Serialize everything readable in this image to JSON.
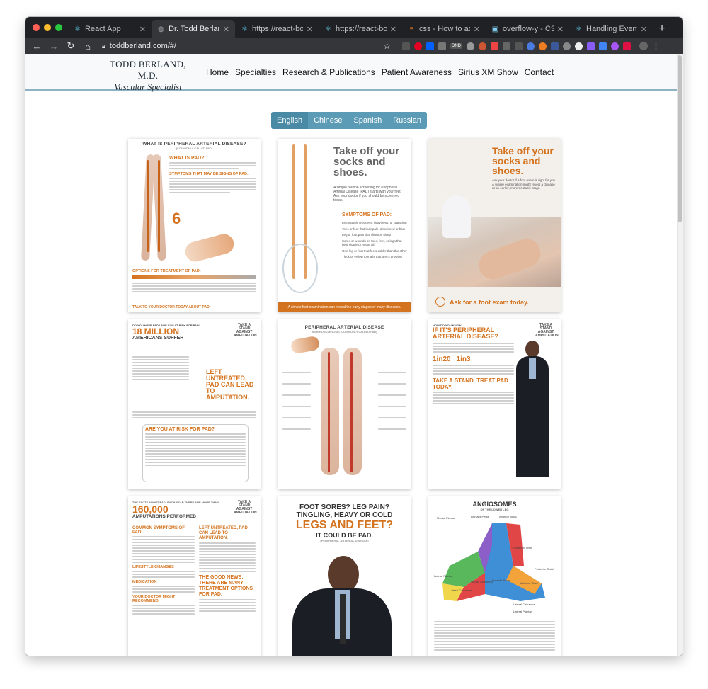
{
  "browser": {
    "tabs": [
      {
        "label": "React App",
        "icon": "react-icon",
        "active": false
      },
      {
        "label": "Dr. Todd Berland, MD",
        "icon": "globe-icon",
        "active": true
      },
      {
        "label": "https://react-bootstr",
        "icon": "react-icon",
        "active": false
      },
      {
        "label": "https://react-bootstr",
        "icon": "react-icon",
        "active": false
      },
      {
        "label": "css - How to add a s",
        "icon": "stackoverflow-icon",
        "active": false
      },
      {
        "label": "overflow-y - CSS: Ca",
        "icon": "mdn-icon",
        "active": false
      },
      {
        "label": "Handling Events – Re",
        "icon": "react-icon",
        "active": false
      }
    ],
    "url": "toddberland.com/#/",
    "extension_badge": "DND"
  },
  "site": {
    "brand_name": "TODD BERLAND, M.D.",
    "brand_sub": "Vascular Specialist",
    "nav": [
      "Home",
      "Specialties",
      "Research & Publications",
      "Patient Awareness",
      "Sirius XM Show",
      "Contact"
    ],
    "languages": [
      "English",
      "Chinese",
      "Spanish",
      "Russian"
    ],
    "active_language": "English"
  },
  "posters": {
    "p1": {
      "title": "WHAT IS PERIPHERAL ARTERIAL DISEASE?",
      "sub": "(COMMONLY CALLED PAD)",
      "h1": "WHAT IS PAD?",
      "h2": "SYMPTOMS THAT MAY BE SIGNS OF PAD:",
      "h3": "OPTIONS FOR TREATMENT OF PAD:",
      "footer": "TALK TO YOUR DOCTOR TODAY ABOUT PAD.",
      "big": "6"
    },
    "p2": {
      "title": "Take off your socks and shoes.",
      "body": "A simple routine screening for Peripheral Arterial Disease (PAD) starts with your feet. Ask your doctor if you should be screened today.",
      "symptoms_title": "SYMPTOMS OF PAD:",
      "symptoms": [
        "Leg muscle tiredness, heaviness, or cramping",
        "Toes or feet that look pale, discolored or blue",
        "Leg or foot pain that disturbs sleep",
        "Sores or wounds on toes, feet, or legs that heal slowly or not at all",
        "One leg or foot that feels colder than the other",
        "Thick or yellow toenails that aren't growing"
      ],
      "footer": "A simple foot examination can reveal the early stages of many diseases."
    },
    "p3": {
      "title": "Take off your socks and shoes.",
      "body": "Ask your doctor if a foot exam is right for you. A simple examination might reveal a disease at an earlier, more treatable stage.",
      "footer": "Ask for a foot exam today."
    },
    "p4": {
      "pre": "DO YOU HAVE PAD? ARE YOU AT RISK FOR PAD?",
      "big": "18 MILLION",
      "big2": "AMERICANS SUFFER",
      "mid": "LEFT UNTREATED, PAD CAN LEAD TO AMPUTATION.",
      "quiz": "ARE YOU AT RISK FOR PAD?",
      "logo": "TAKE A STAND AGAINST AMPUTATION"
    },
    "p5": {
      "title": "PERIPHERAL ARTERIAL DISEASE",
      "sub": "ATHEROSCLEROSIS (COMMONLY CALLED PAD)"
    },
    "p6": {
      "pre": "HOW DO YOU KNOW",
      "title": "IF IT'S PERIPHERAL ARTERIAL DISEASE?",
      "stat1": "1in20",
      "stat2": "1in3",
      "cta": "TAKE A STAND. TREAT PAD TODAY.",
      "logo": "TAKE A STAND AGAINST AMPUTATION"
    },
    "p7": {
      "pre": "THE FACTS ABOUT PAD: EACH YEAR THERE ARE MORE THAN",
      "big": "160,000",
      "big2": "AMPUTATIONS PERFORMED",
      "h1": "COMMON SYMPTOMS OF PAD:",
      "h2": "LEFT UNTREATED, PAD CAN LEAD TO AMPUTATION.",
      "h3": "THE GOOD NEWS: THERE ARE MANY TREATMENT OPTIONS FOR PAD.",
      "h4": "LIFESTYLE CHANGES",
      "h5": "MEDICATION",
      "h6": "YOUR DOCTOR MIGHT RECOMMEND:",
      "logo": "TAKE A STAND AGAINST AMPUTATION"
    },
    "p8": {
      "line1": "FOOT SORES? LEG PAIN?",
      "line2": "TINGLING, HEAVY OR COLD",
      "line3": "LEGS AND FEET?",
      "line4": "IT COULD BE PAD.",
      "line5": "(PERIPHERAL ARTERIAL DISEASE)"
    },
    "p9": {
      "title": "ANGIOSOMES",
      "sub": "OF THE LOWER LEG",
      "labels": [
        "Medial Plantar",
        "Dorsalis Pedis",
        "Anterior Tibial",
        "Posterior Tibial",
        "Lateral Plantar",
        "Lateral Calcaneal",
        "Medial Calcaneal",
        "Dorsalis Pedis",
        "Anterior Tibial",
        "Posterior Tibial",
        "Lateral Calcaneal",
        "Lateral Plantar"
      ]
    }
  },
  "colors": {
    "accent": "#d4731f",
    "button": "#5b9bb5",
    "header_border": "#8fb1c4"
  }
}
